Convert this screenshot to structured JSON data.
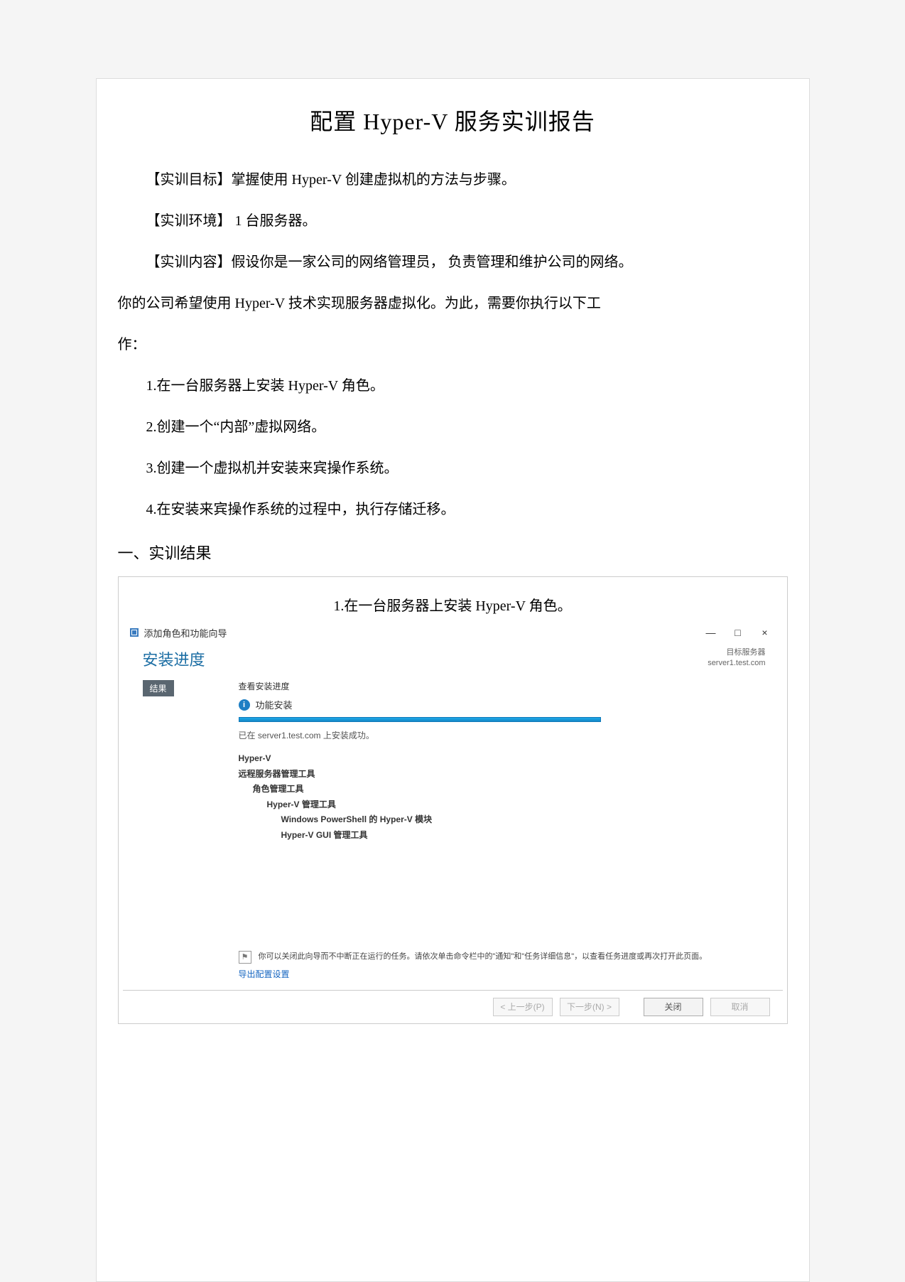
{
  "doc": {
    "title": "配置   Hyper-V      服务实训报告",
    "p1": "【实训目标】掌握使用    Hyper-V    创建虚拟机的方法与步骤。",
    "p2": "【实训环境】  1 台服务器。",
    "p3a": "【实训内容】假设你是一家公司的网络管理员，     负责管理和维护公司的网络。",
    "p3b": "你的公司希望使用    Hyper-V    技术实现服务器虚拟化。为此，需要你执行以下工",
    "p3c": "作：",
    "li1": "1.在一台服务器上安装    Hyper-V    角色。",
    "li2": "2.创建一个“内部”虚拟网络。",
    "li3": "3.创建一个虚拟机并安装来宾操作系统。",
    "li4": "4.在安装来宾操作系统的过程中，执行存储迁移。",
    "section1": "一、实训结果",
    "caption1": "1.在一台服务器上安装    Hyper-V    角色。"
  },
  "wizard": {
    "window_title": "添加角色和功能向导",
    "heading": "安装进度",
    "target_label": "目标服务器",
    "target_value": "server1.test.com",
    "sidebar_step": "结果",
    "view_progress": "查看安装进度",
    "feature_install": "功能安装",
    "success_msg": "已在 server1.test.com 上安装成功。",
    "tree": {
      "n1": "Hyper-V",
      "n2": "远程服务器管理工具",
      "n3": "角色管理工具",
      "n4": "Hyper-V 管理工具",
      "n5": "Windows PowerShell 的 Hyper-V 模块",
      "n6": "Hyper-V GUI 管理工具"
    },
    "note": "你可以关闭此向导而不中断正在运行的任务。请依次单击命令栏中的\"通知\"和\"任务详细信息\"，以查看任务进度或再次打开此页面。",
    "export_link": "导出配置设置",
    "buttons": {
      "prev": "< 上一步(P)",
      "next": "下一步(N) >",
      "close": "关闭",
      "cancel": "取消"
    },
    "win_min": "—",
    "win_max": "□",
    "win_close": "×"
  }
}
